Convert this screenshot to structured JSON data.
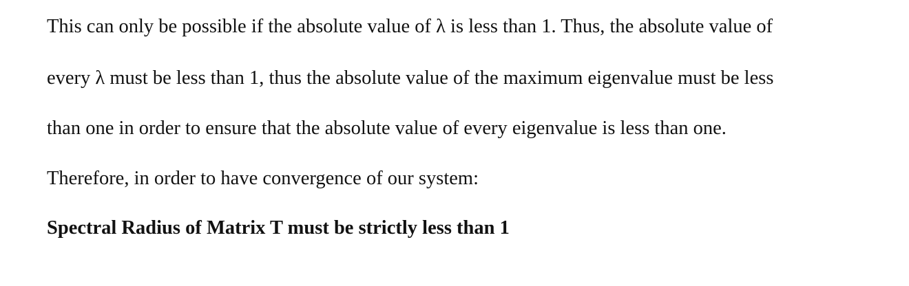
{
  "document": {
    "lines": [
      "This can only be possible if the absolute value of  λ is less than 1. Thus, the absolute value of",
      "every λ must be less than 1, thus the absolute value of the maximum eigenvalue must be less",
      "than one in order to ensure that the absolute value of every eigenvalue is less than one.",
      "Therefore, in order to have convergence of our system:"
    ],
    "conclusion": "Spectral Radius of Matrix T must be strictly less than 1"
  }
}
